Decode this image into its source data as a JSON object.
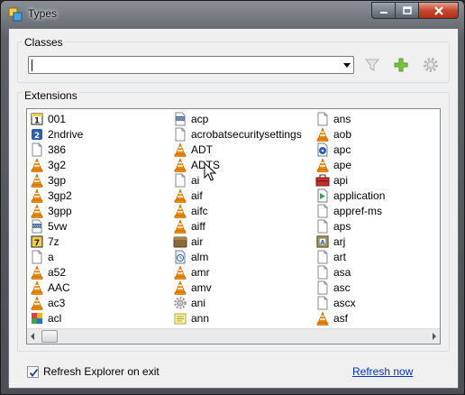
{
  "window": {
    "title": "Types"
  },
  "classes": {
    "label": "Classes",
    "value": ""
  },
  "extensions": {
    "label": "Extensions",
    "columns": [
      [
        {
          "label": "001",
          "icon": "boxed-1-icon"
        },
        {
          "label": "2ndrive",
          "icon": "blue-2-icon"
        },
        {
          "label": "386",
          "icon": "blank-file-icon"
        },
        {
          "label": "3g2",
          "icon": "vlc-cone-icon"
        },
        {
          "label": "3gp",
          "icon": "vlc-cone-icon"
        },
        {
          "label": "3gp2",
          "icon": "vlc-cone-icon"
        },
        {
          "label": "3gpp",
          "icon": "vlc-cone-icon"
        },
        {
          "label": "5vw",
          "icon": "binary-file-icon"
        },
        {
          "label": "7z",
          "icon": "archive-7z-icon"
        },
        {
          "label": "a",
          "icon": "blank-file-icon"
        },
        {
          "label": "a52",
          "icon": "vlc-cone-icon"
        },
        {
          "label": "AAC",
          "icon": "vlc-cone-icon"
        },
        {
          "label": "ac3",
          "icon": "vlc-cone-icon"
        },
        {
          "label": "acl",
          "icon": "colorful-grid-icon"
        }
      ],
      [
        {
          "label": "acp",
          "icon": "binary-file-icon"
        },
        {
          "label": "acrobatsecuritysettings",
          "icon": "blank-file-icon"
        },
        {
          "label": "ADT",
          "icon": "vlc-cone-icon"
        },
        {
          "label": "ADTS",
          "icon": "vlc-cone-icon"
        },
        {
          "label": "ai",
          "icon": "blank-file-icon"
        },
        {
          "label": "aif",
          "icon": "vlc-cone-icon"
        },
        {
          "label": "aifc",
          "icon": "vlc-cone-icon"
        },
        {
          "label": "aiff",
          "icon": "vlc-cone-icon"
        },
        {
          "label": "air",
          "icon": "air-package-icon"
        },
        {
          "label": "alm",
          "icon": "alarm-file-icon"
        },
        {
          "label": "amr",
          "icon": "vlc-cone-icon"
        },
        {
          "label": "amv",
          "icon": "vlc-cone-icon"
        },
        {
          "label": "ani",
          "icon": "gear-file-icon"
        },
        {
          "label": "ann",
          "icon": "notes-file-icon"
        }
      ],
      [
        {
          "label": "ans",
          "icon": "blank-file-icon"
        },
        {
          "label": "aob",
          "icon": "vlc-cone-icon"
        },
        {
          "label": "apc",
          "icon": "blue-disc-file-icon"
        },
        {
          "label": "ape",
          "icon": "vlc-cone-icon"
        },
        {
          "label": "api",
          "icon": "red-toolbox-icon"
        },
        {
          "label": "application",
          "icon": "application-file-icon"
        },
        {
          "label": "appref-ms",
          "icon": "blank-file-icon"
        },
        {
          "label": "aps",
          "icon": "blank-file-icon"
        },
        {
          "label": "arj",
          "icon": "archive-a-icon"
        },
        {
          "label": "art",
          "icon": "blank-file-icon"
        },
        {
          "label": "asa",
          "icon": "blank-file-icon"
        },
        {
          "label": "asc",
          "icon": "blank-file-icon"
        },
        {
          "label": "ascx",
          "icon": "blank-file-icon"
        },
        {
          "label": "asf",
          "icon": "vlc-cone-icon"
        }
      ]
    ]
  },
  "footer": {
    "refresh_on_exit_label": "Refresh Explorer on exit",
    "refresh_on_exit_checked": true,
    "refresh_now_label": "Refresh now"
  },
  "colors": {
    "link": "#0033cc",
    "vlc_orange": "#f08a00",
    "add_green": "#7ac143"
  }
}
